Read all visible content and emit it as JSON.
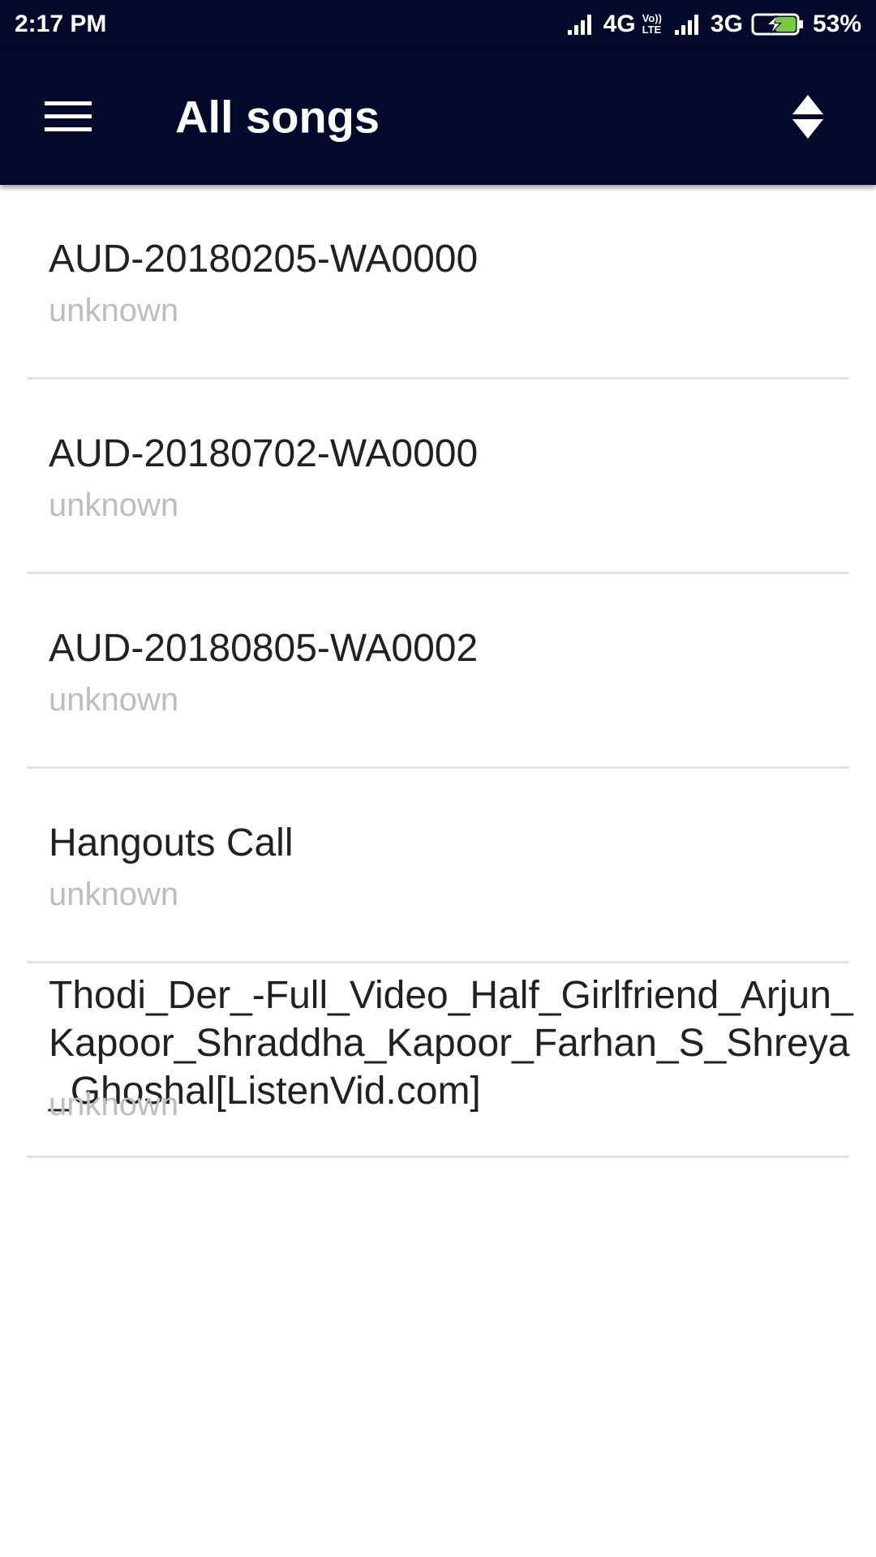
{
  "status_bar": {
    "time": "2:17 PM",
    "network1": "4G",
    "volte_top": "Vo))",
    "volte_bottom": "LTE",
    "network2": "3G",
    "battery": "53%"
  },
  "app_bar": {
    "title": "All songs"
  },
  "songs": [
    {
      "title": "AUD-20180205-WA0000",
      "artist": "unknown"
    },
    {
      "title": "AUD-20180702-WA0000",
      "artist": "unknown"
    },
    {
      "title": "AUD-20180805-WA0002",
      "artist": "unknown"
    },
    {
      "title": "Hangouts Call",
      "artist": "unknown"
    },
    {
      "title": "Thodi_Der_-Full_Video_Half_Girlfriend_Arjun_Kapoor_Shraddha_Kapoor_Farhan_S_Shreya_Ghoshal[ListenVid.com]",
      "artist": "unknown"
    }
  ],
  "colors": {
    "app_bar_bg": "#04082a",
    "title_text": "#212121",
    "artist_text": "#bdbdbd",
    "battery_charge": "#7ac943"
  }
}
